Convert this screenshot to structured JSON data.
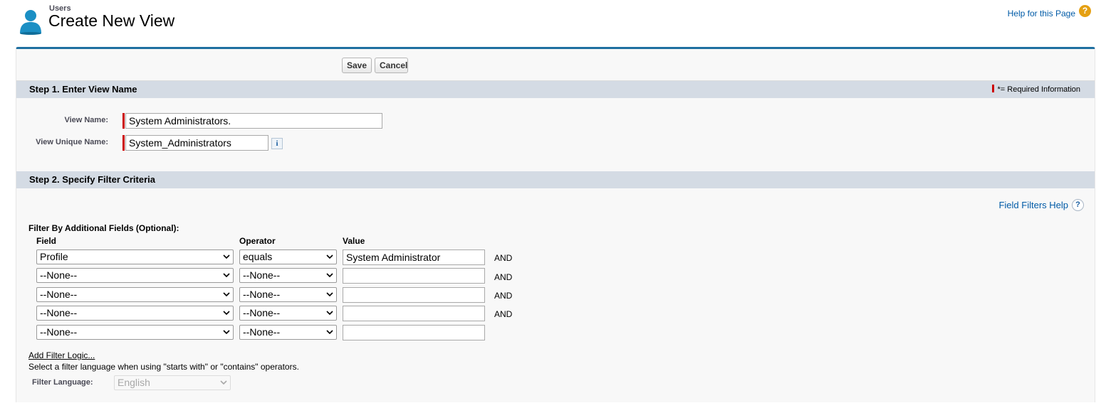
{
  "header": {
    "breadcrumb": "Users",
    "title": "Create New View",
    "help_link": "Help for this Page"
  },
  "toolbar": {
    "save_label": "Save",
    "cancel_label": "Cancel"
  },
  "step1": {
    "heading": "Step 1. Enter View Name",
    "required_legend": "= Required Information",
    "view_name_label": "View Name:",
    "view_name_value": "System Administrators.",
    "unique_name_label": "View Unique Name:",
    "unique_name_value": "System_Administrators"
  },
  "step2": {
    "heading": "Step 2. Specify Filter Criteria",
    "field_filters_help": "Field Filters Help",
    "filter_title": "Filter By Additional Fields (Optional):",
    "col_field": "Field",
    "col_operator": "Operator",
    "col_value": "Value",
    "rows": [
      {
        "field": "Profile",
        "operator": "equals",
        "value": "System Administrator",
        "conj": "AND"
      },
      {
        "field": "--None--",
        "operator": "--None--",
        "value": "",
        "conj": "AND"
      },
      {
        "field": "--None--",
        "operator": "--None--",
        "value": "",
        "conj": "AND"
      },
      {
        "field": "--None--",
        "operator": "--None--",
        "value": "",
        "conj": "AND"
      },
      {
        "field": "--None--",
        "operator": "--None--",
        "value": "",
        "conj": ""
      }
    ],
    "add_filter_logic": "Add Filter Logic...",
    "language_note": "Select a filter language when using \"starts with\" or \"contains\" operators.",
    "filter_language_label": "Filter Language:",
    "filter_language_value": "English"
  },
  "colors": {
    "accent": "#1f6fa0",
    "section_header": "#d4dbe4",
    "required": "#cc0000",
    "link": "#015ba7",
    "help_icon": "#e5a012"
  },
  "icons": {
    "user": "user-icon",
    "help": "help-icon",
    "info": "info-icon",
    "field_filters_help": "question-icon",
    "dropdown": "chevron-down-icon"
  }
}
